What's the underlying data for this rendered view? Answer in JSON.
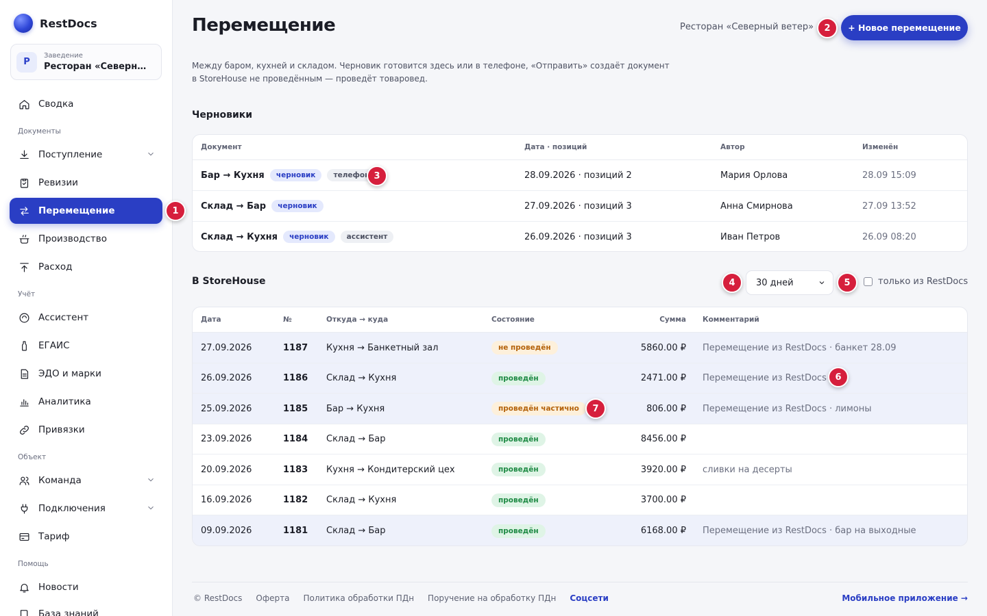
{
  "brand": {
    "name": "RestDocs"
  },
  "venue": {
    "label": "Заведение",
    "avatar": "Р",
    "name": "Ресторан «Северный ветер»"
  },
  "sidebar": {
    "summary": "Сводка",
    "section_docs": "Документы",
    "receipt": "Поступление",
    "inventory": "Ревизии",
    "transfer": "Перемещение",
    "production": "Производство",
    "expense": "Расход",
    "section_accounting": "Учёт",
    "assistant": "Ассистент",
    "egais": "ЕГАИС",
    "edo": "ЭДО и марки",
    "analytics": "Аналитика",
    "bindings": "Привязки",
    "section_object": "Объект",
    "team": "Команда",
    "connections": "Подключения",
    "tariff": "Тариф",
    "section_help": "Помощь",
    "news": "Новости",
    "kb": "База знаний"
  },
  "header": {
    "title": "Перемещение",
    "venue_crumb": "Ресторан «Северный ветер»",
    "new_button": "+ Новое перемещение",
    "intro": "Между баром, кухней и складом. Черновик готовится здесь или в телефоне, «Отправить» создаёт документ в StoreHouse не проведённым — проведёт товаровед."
  },
  "drafts": {
    "title": "Черновики",
    "columns": {
      "doc": "Документ",
      "date": "Дата · позиций",
      "author": "Автор",
      "modified": "Изменён"
    },
    "rows": [
      {
        "name": "Бар → Кухня",
        "tag": "черновик",
        "source": "телефон",
        "date": "28.09.2026 · позиций 2",
        "author": "Мария Орлова",
        "modified": "28.09 15:09"
      },
      {
        "name": "Склад → Бар",
        "tag": "черновик",
        "source": "",
        "date": "27.09.2026 · позиций 3",
        "author": "Анна Смирнова",
        "modified": "27.09 13:52"
      },
      {
        "name": "Склад → Кухня",
        "tag": "черновик",
        "source": "ассистент",
        "date": "26.09.2026 · позиций 3",
        "author": "Иван Петров",
        "modified": "26.09 08:20"
      }
    ]
  },
  "storehouse": {
    "title": "В StoreHouse",
    "period": "30 дней",
    "only_restdocs": "только из RestDocs",
    "columns": {
      "date": "Дата",
      "num": "№",
      "route": "Откуда → куда",
      "state": "Состояние",
      "sum": "Сумма",
      "comment": "Комментарий"
    },
    "rows": [
      {
        "date": "27.09.2026",
        "num": "1187",
        "route": "Кухня → Банкетный зал",
        "state": "не проведён",
        "state_kind": "no",
        "sum": "5860.00 ₽",
        "comment": "Перемещение из RestDocs · банкет 28.09",
        "hl": true
      },
      {
        "date": "26.09.2026",
        "num": "1186",
        "route": "Склад → Кухня",
        "state": "проведён",
        "state_kind": "ok",
        "sum": "2471.00 ₽",
        "comment": "Перемещение из RestDocs",
        "hl": true
      },
      {
        "date": "25.09.2026",
        "num": "1185",
        "route": "Бар → Кухня",
        "state": "проведён частично",
        "state_kind": "part",
        "sum": "806.00 ₽",
        "comment": "Перемещение из RestDocs · лимоны",
        "hl": true
      },
      {
        "date": "23.09.2026",
        "num": "1184",
        "route": "Склад → Бар",
        "state": "проведён",
        "state_kind": "ok",
        "sum": "8456.00 ₽",
        "comment": "",
        "hl": false
      },
      {
        "date": "20.09.2026",
        "num": "1183",
        "route": "Кухня → Кондитерский цех",
        "state": "проведён",
        "state_kind": "ok",
        "sum": "3920.00 ₽",
        "comment": "сливки на десерты",
        "hl": false
      },
      {
        "date": "16.09.2026",
        "num": "1182",
        "route": "Склад → Кухня",
        "state": "проведён",
        "state_kind": "ok",
        "sum": "3700.00 ₽",
        "comment": "",
        "hl": false
      },
      {
        "date": "09.09.2026",
        "num": "1181",
        "route": "Склад → Бар",
        "state": "проведён",
        "state_kind": "ok",
        "sum": "6168.00 ₽",
        "comment": "Перемещение из RestDocs · бар на выходные",
        "hl": true
      }
    ]
  },
  "footer": {
    "copyright": "© RestDocs",
    "offer": "Оферта",
    "policy": "Политика обработки ПДн",
    "assignment": "Поручение на обработку ПДн",
    "social": "Соцсети",
    "mobile": "Мобильное приложение →"
  },
  "markers": [
    "1",
    "2",
    "3",
    "4",
    "5",
    "6",
    "7"
  ],
  "colors": {
    "accent": "#2a3ec4",
    "marker": "#d61f3c",
    "ok": "#1e8a44",
    "warn": "#b4620a"
  }
}
